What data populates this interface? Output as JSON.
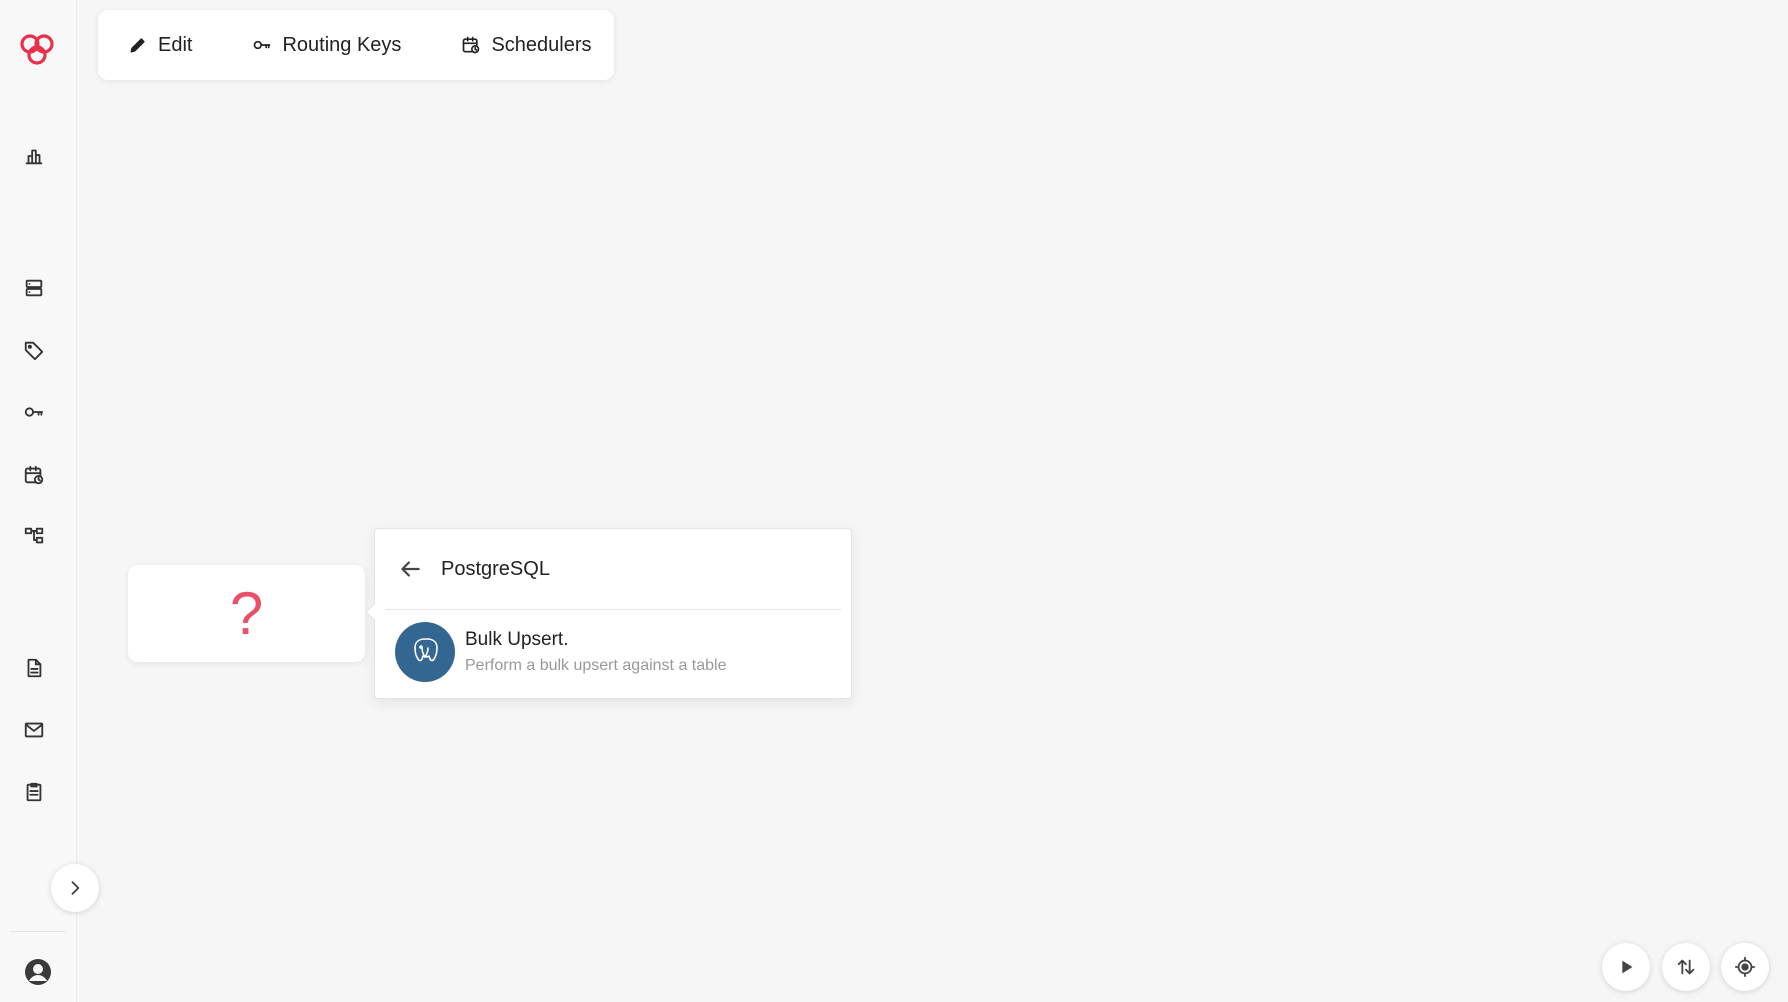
{
  "toolbar": {
    "edit_label": "Edit",
    "routing_keys_label": "Routing Keys",
    "schedulers_label": "Schedulers"
  },
  "sidebar": {
    "icons": [
      "analytics-icon",
      "storage-icon",
      "tag-icon",
      "key-icon",
      "scheduler-icon",
      "workflow-icon",
      "document-icon",
      "mail-icon",
      "clipboard-icon"
    ]
  },
  "canvas": {
    "unknown_node_symbol": "?"
  },
  "popover": {
    "title": "PostgreSQL",
    "items": [
      {
        "title": "Bulk Upsert.",
        "description": "Perform a bulk upsert against a table",
        "icon": "postgresql-icon"
      }
    ]
  },
  "colors": {
    "brand": "#e8304a",
    "question_mark": "#e8506a",
    "postgres_blue": "#336791"
  }
}
